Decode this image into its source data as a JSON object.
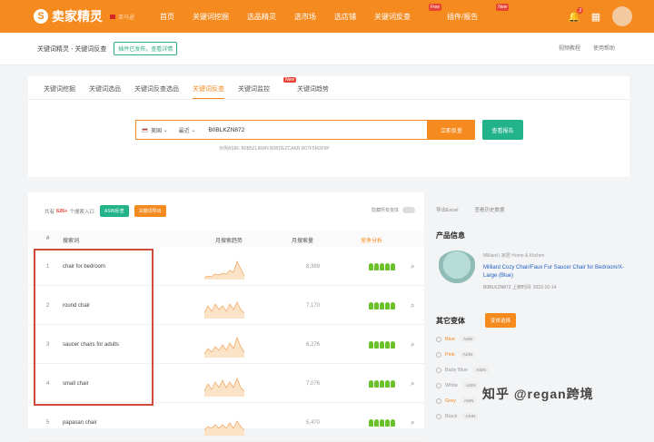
{
  "header": {
    "logo": "卖家精灵",
    "logo_mark": "S",
    "region": "亚马逊",
    "nav": [
      {
        "label": "首页"
      },
      {
        "label": "关键词挖掘"
      },
      {
        "label": "选品精灵"
      },
      {
        "label": "选市场"
      },
      {
        "label": "选店铺"
      },
      {
        "label": "关键词反查",
        "badge": "Free"
      },
      {
        "label": "插件/报告",
        "badge": "New"
      }
    ],
    "notification_count": "3"
  },
  "breadcrumb": {
    "path": "关键词精灵 - 关键词反查",
    "notice": "插件已发布，查看详情",
    "help": "视频教程",
    "guide": "使用帮助"
  },
  "tabs": [
    {
      "label": "关键词挖掘",
      "active": false
    },
    {
      "label": "关键词选品",
      "active": false
    },
    {
      "label": "关键词反查选品",
      "active": false
    },
    {
      "label": "关键词反查",
      "active": true
    },
    {
      "label": "关键词监控",
      "active": false,
      "hot": "New"
    },
    {
      "label": "关键词趋势",
      "active": false
    }
  ],
  "search": {
    "marketplace": "美国",
    "period": "最近",
    "value": "B0BLKZN872",
    "query_button": "立即反查",
    "report_button": "查看报告",
    "examples": "示例ASIN: B0B5ZLIRRN  B0BDEZCAKR  B07F5M3F9P"
  },
  "results": {
    "prefix": "共有",
    "count": "626+",
    "suffix": "个搜索入口",
    "asin_button": "ASIN反查",
    "export_button": "关键词导出",
    "toggle_label": "隐藏所有变体",
    "headers": {
      "keyword": "搜索词",
      "trend": "月搜索趋势",
      "volume": "月搜索量",
      "competition": "竞争分析"
    },
    "rows": [
      {
        "num": "1",
        "keyword": "chair for bedroom",
        "volume": "8,389"
      },
      {
        "num": "2",
        "keyword": "round chair",
        "volume": "7,170"
      },
      {
        "num": "3",
        "keyword": "saucer chairs for adults",
        "volume": "6,276"
      },
      {
        "num": "4",
        "keyword": "small chair",
        "volume": "7,076"
      },
      {
        "num": "5",
        "keyword": "papasan chair",
        "volume": "5,470"
      }
    ]
  },
  "sidebar": {
    "btn1": "导出Excel",
    "btn2": "查看历史数据",
    "product_heading": "产品信息",
    "category": "Milliard  |  家居  Home & Kitchen",
    "title": "Milliard Cozy Chair/Faux Fur Saucer Chair for Bedroom/X-Large (Blue)",
    "meta": "B0BLKZN872   上架时间: 2022-10-14",
    "variants_heading": "其它变体",
    "variants_button": "变体选择",
    "variants": [
      {
        "name": "Blue",
        "tag": "ASIN"
      },
      {
        "name": "Pink",
        "tag": "ASIN"
      },
      {
        "name": "Baby Blue",
        "tag": "ASIN"
      },
      {
        "name": "White",
        "tag": "ASIN"
      },
      {
        "name": "Grey",
        "tag": "ASIN"
      },
      {
        "name": "Black",
        "tag": "ASIN"
      }
    ]
  },
  "watermark": "知乎 @regan跨境",
  "colors": {
    "brand": "#f58a1f",
    "accent": "#22b38a",
    "alert": "#e84335"
  },
  "icons": [
    "bell-icon",
    "grid-icon",
    "search-icon",
    "user-icon"
  ]
}
